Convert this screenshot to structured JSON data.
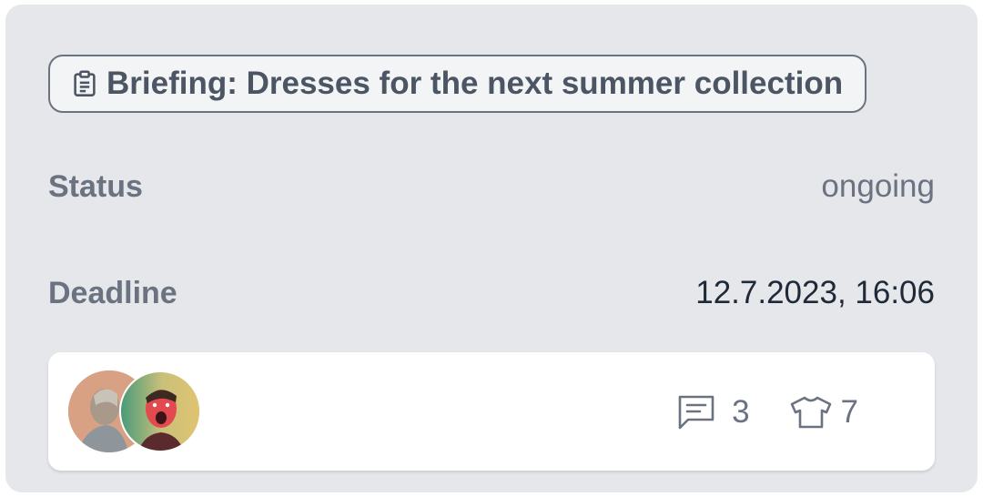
{
  "briefing": {
    "icon": "clipboard-icon",
    "label": "Briefing: Dresses for the next summer collection"
  },
  "details": {
    "status_label": "Status",
    "status_value": "ongoing",
    "deadline_label": "Deadline",
    "deadline_value": "12.7.2023, 16:06"
  },
  "footer": {
    "avatars": [
      "avatar-person-1",
      "avatar-person-2"
    ],
    "comments": {
      "icon": "comment-icon",
      "count": "3"
    },
    "items": {
      "icon": "tshirt-icon",
      "count": "7"
    }
  },
  "colors": {
    "card_background": "#e5e7eb",
    "label_text": "#6b7280",
    "value_text": "#1f2937",
    "footer_background": "#ffffff"
  }
}
